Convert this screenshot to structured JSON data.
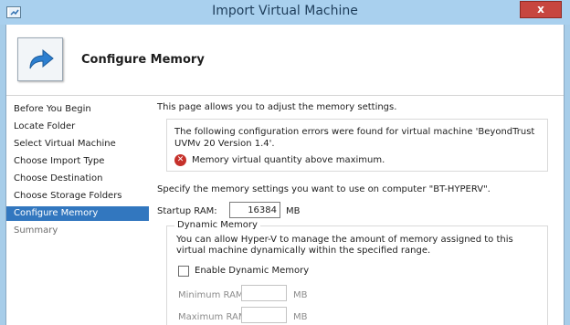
{
  "window": {
    "title": "Import Virtual Machine",
    "close_label": "x",
    "system_icon": "hyperv-window-icon"
  },
  "header": {
    "title": "Configure Memory",
    "icon": "import-arrow-icon"
  },
  "nav": {
    "items": [
      {
        "label": "Before You Begin",
        "state": "normal"
      },
      {
        "label": "Locate Folder",
        "state": "normal"
      },
      {
        "label": "Select Virtual Machine",
        "state": "normal"
      },
      {
        "label": "Choose Import Type",
        "state": "normal"
      },
      {
        "label": "Choose Destination",
        "state": "normal"
      },
      {
        "label": "Choose Storage Folders",
        "state": "normal"
      },
      {
        "label": "Configure Memory",
        "state": "active"
      },
      {
        "label": "Summary",
        "state": "disabled"
      }
    ]
  },
  "main": {
    "intro": "This page allows you to adjust the memory settings.",
    "errors": {
      "text": "The following configuration errors were found for virtual machine 'BeyondTrust UVMv 20 Version 1.4'.",
      "message": "Memory virtual quantity above maximum."
    },
    "specify": "Specify the memory settings you want to use on computer \"BT-HYPERV\".",
    "startup_ram": {
      "label": "Startup RAM:",
      "value": "16384",
      "unit": "MB"
    },
    "dynamic_memory": {
      "title": "Dynamic Memory",
      "description": "You can allow Hyper-V to manage the amount of memory assigned to this virtual machine dynamically within the specified range.",
      "checkbox_label": "Enable Dynamic Memory",
      "checked": false,
      "minimum_label": "Minimum RAM:",
      "minimum_unit": "MB",
      "maximum_label": "Maximum RAM:",
      "maximum_unit": "MB"
    }
  },
  "colors": {
    "titlebar": "#a9d0ee",
    "active_nav": "#3277bf",
    "close_button": "#c7463f",
    "error_icon": "#c6312b"
  }
}
